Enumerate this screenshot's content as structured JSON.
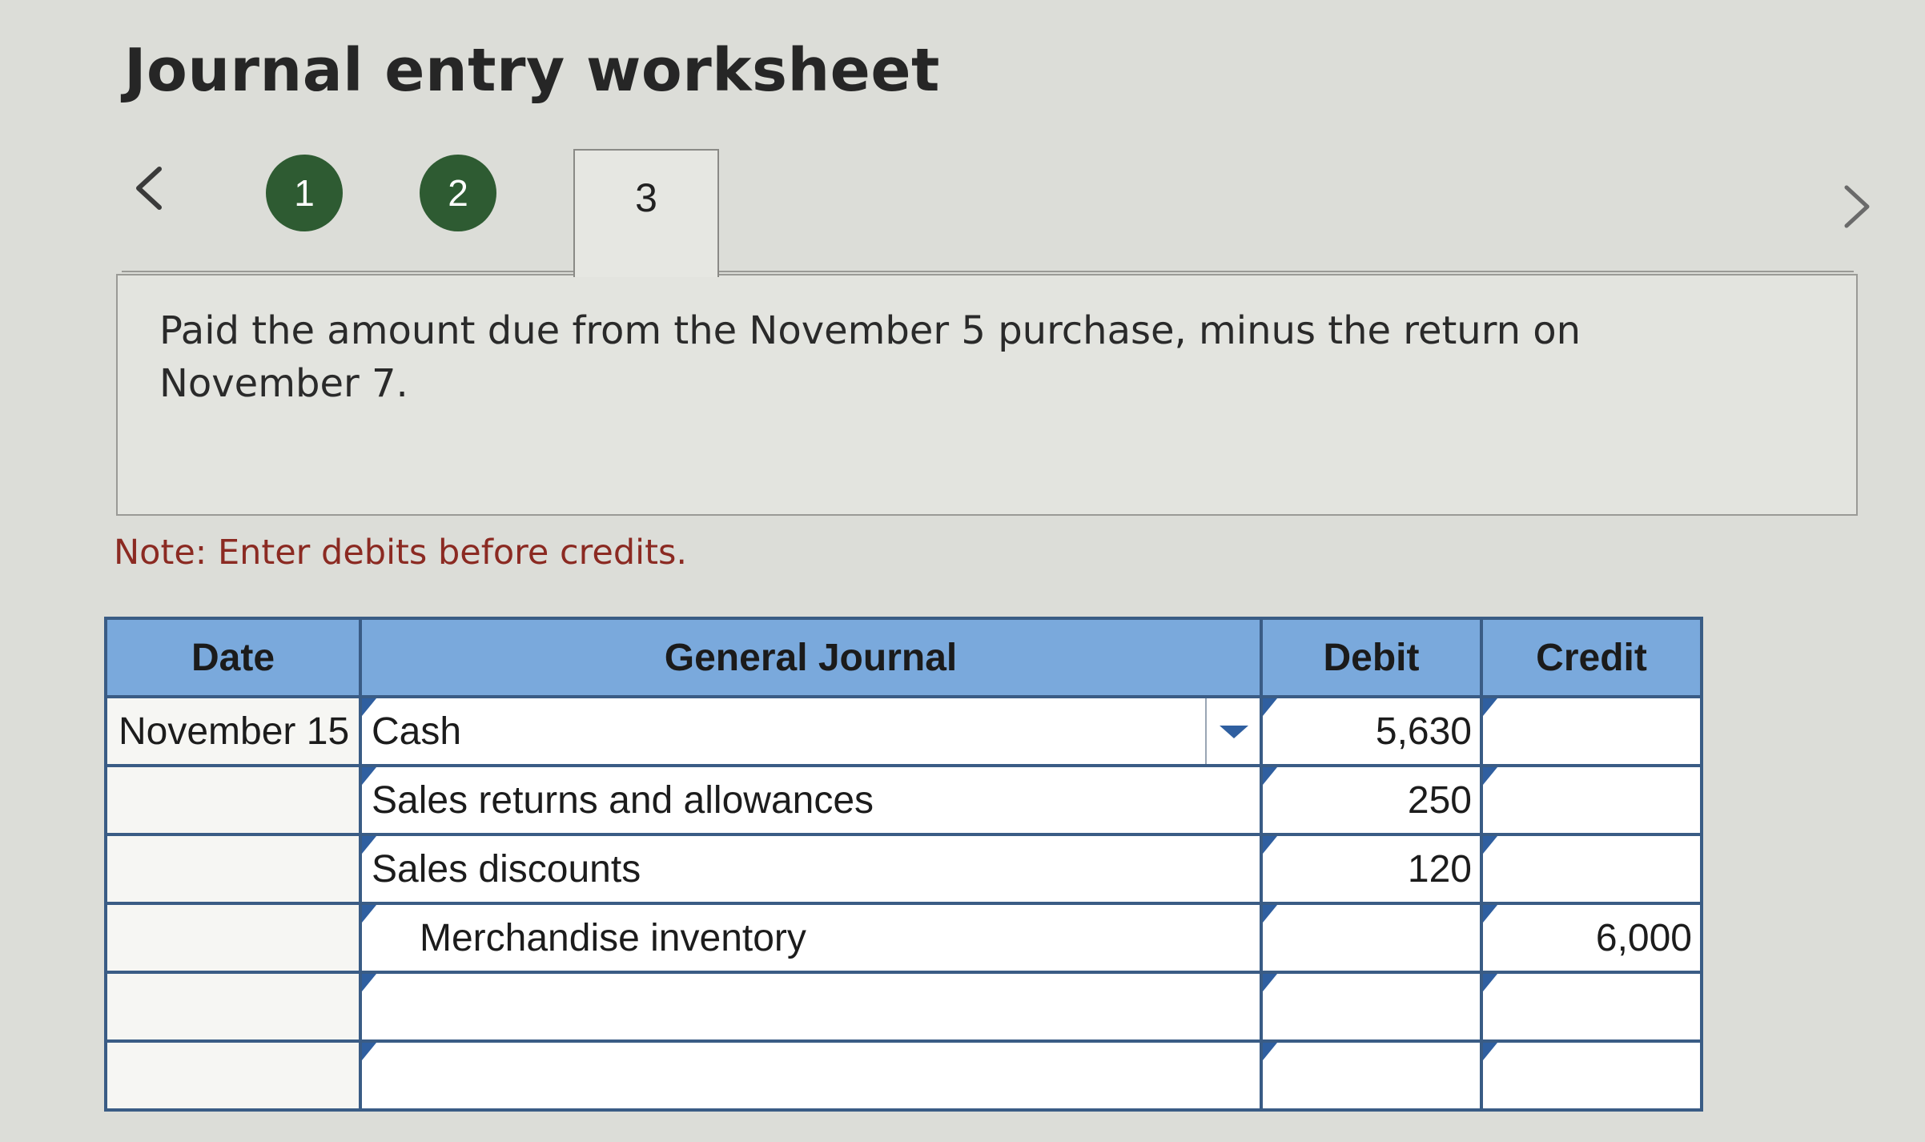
{
  "page": {
    "title": "Journal entry worksheet"
  },
  "steps": {
    "prev_icon": "chevron-left-icon",
    "next_icon": "chevron-right-icon",
    "items": [
      {
        "label": "1",
        "state": "completed"
      },
      {
        "label": "2",
        "state": "completed"
      },
      {
        "label": "3",
        "state": "active"
      }
    ],
    "completed_color": "#2e5b32"
  },
  "question": {
    "text": "Paid the amount due from the November 5 purchase, minus the return on November 7."
  },
  "note": {
    "text": "Note: Enter debits before credits.",
    "color": "#8b2a22"
  },
  "journal": {
    "header_color": "#7aa9dc",
    "columns": [
      "Date",
      "General Journal",
      "Debit",
      "Credit"
    ],
    "rows": [
      {
        "date": "November 15",
        "account": "Cash",
        "debit": "5,630",
        "credit": ""
      },
      {
        "date": "",
        "account": "Sales returns and allowances",
        "debit": "250",
        "credit": ""
      },
      {
        "date": "",
        "account": "Sales discounts",
        "debit": "120",
        "credit": ""
      },
      {
        "date": "",
        "account": "Merchandise inventory",
        "debit": "",
        "credit": "6,000"
      },
      {
        "date": "",
        "account": "",
        "debit": "",
        "credit": ""
      },
      {
        "date": "",
        "account": "",
        "debit": "",
        "credit": ""
      }
    ]
  }
}
